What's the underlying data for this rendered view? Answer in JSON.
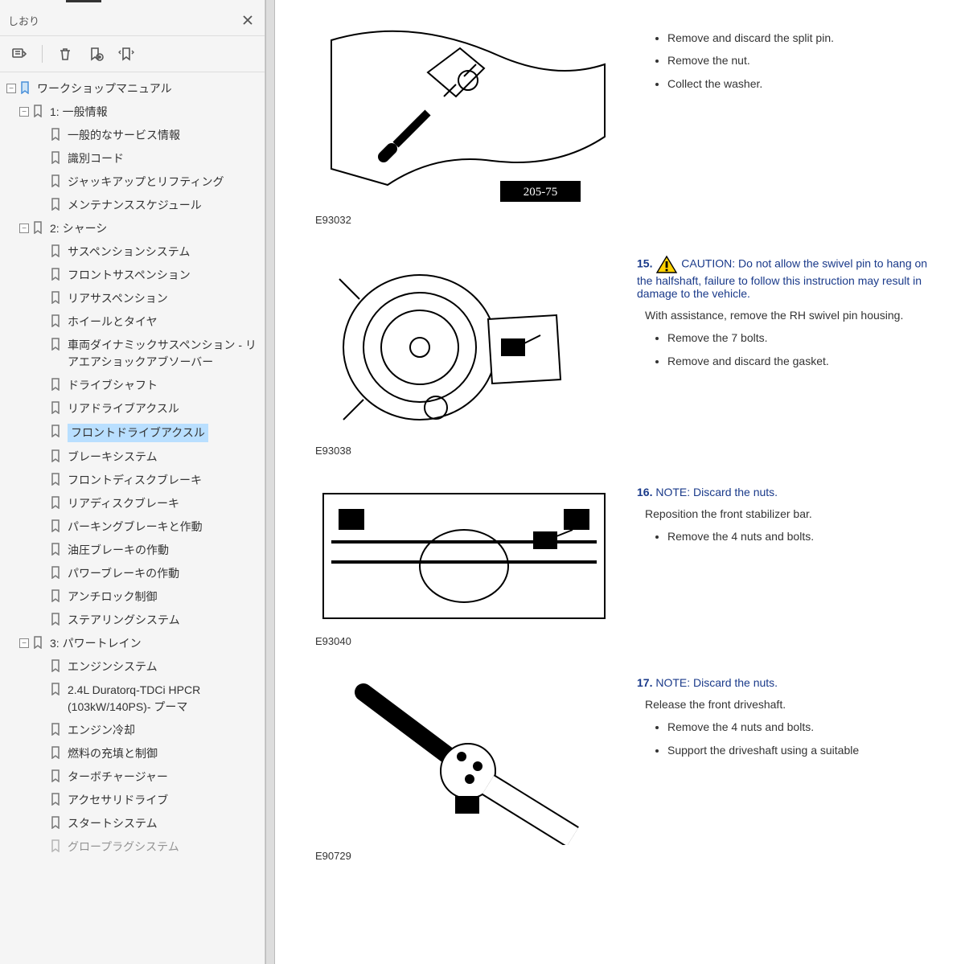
{
  "sidebar": {
    "title": "しおり",
    "tree": [
      {
        "level": 0,
        "label": "ワークショップマニュアル",
        "toggle": "−",
        "root": true
      },
      {
        "level": 1,
        "label": "1: 一般情報",
        "toggle": "−"
      },
      {
        "level": 2,
        "label": "一般的なサービス情報"
      },
      {
        "level": 2,
        "label": "識別コード"
      },
      {
        "level": 2,
        "label": "ジャッキアップとリフティング"
      },
      {
        "level": 2,
        "label": "メンテナンススケジュール"
      },
      {
        "level": 1,
        "label": "2: シャーシ",
        "toggle": "−"
      },
      {
        "level": 2,
        "label": "サスペンションシステム"
      },
      {
        "level": 2,
        "label": "フロントサスペンション"
      },
      {
        "level": 2,
        "label": "リアサスペンション"
      },
      {
        "level": 2,
        "label": "ホイールとタイヤ"
      },
      {
        "level": 2,
        "label": "車両ダイナミックサスペンション - リアエアショックアブソーバー"
      },
      {
        "level": 2,
        "label": "ドライブシャフト"
      },
      {
        "level": 2,
        "label": "リアドライブアクスル"
      },
      {
        "level": 2,
        "label": "フロントドライブアクスル",
        "selected": true
      },
      {
        "level": 2,
        "label": "ブレーキシステム"
      },
      {
        "level": 2,
        "label": "フロントディスクブレーキ"
      },
      {
        "level": 2,
        "label": "リアディスクブレーキ"
      },
      {
        "level": 2,
        "label": "パーキングブレーキと作動"
      },
      {
        "level": 2,
        "label": "油圧ブレーキの作動"
      },
      {
        "level": 2,
        "label": "パワーブレーキの作動"
      },
      {
        "level": 2,
        "label": "アンチロック制御"
      },
      {
        "level": 2,
        "label": "ステアリングシステム"
      },
      {
        "level": 1,
        "label": "3: パワートレイン",
        "toggle": "−"
      },
      {
        "level": 2,
        "label": "エンジンシステム"
      },
      {
        "level": 2,
        "label": "2.4L Duratorq-TDCi HPCR (103kW/140PS)- プーマ"
      },
      {
        "level": 2,
        "label": "エンジン冷却"
      },
      {
        "level": 2,
        "label": "燃料の充填と制御"
      },
      {
        "level": 2,
        "label": "ターボチャージャー"
      },
      {
        "level": 2,
        "label": "アクセサリドライブ"
      },
      {
        "level": 2,
        "label": "スタートシステム"
      },
      {
        "level": 2,
        "label": "グロープラグシステム",
        "faded": true
      }
    ]
  },
  "document": {
    "steps": [
      {
        "figure_id": "E93032",
        "figure_label": "205-75",
        "bullets": [
          "Remove and discard the split pin.",
          "Remove the nut.",
          "Collect the washer."
        ]
      },
      {
        "figure_id": "E93038",
        "num": "15.",
        "caution": "CAUTION: Do not allow the swivel pin to hang on the halfshaft, failure to follow this instruction may result in damage to the vehicle.",
        "plain": "With assistance, remove the RH swivel pin housing.",
        "bullets": [
          "Remove the 7 bolts.",
          "Remove and discard the gasket."
        ]
      },
      {
        "figure_id": "E93040",
        "num": "16.",
        "note": "NOTE: Discard the nuts.",
        "plain": "Reposition the front stabilizer bar.",
        "bullets": [
          "Remove the 4 nuts and bolts."
        ]
      },
      {
        "figure_id": "E90729",
        "num": "17.",
        "note": "NOTE: Discard the nuts.",
        "plain": "Release the front driveshaft.",
        "bullets": [
          "Remove the 4 nuts and bolts.",
          "Support the driveshaft using a suitable "
        ]
      }
    ]
  }
}
